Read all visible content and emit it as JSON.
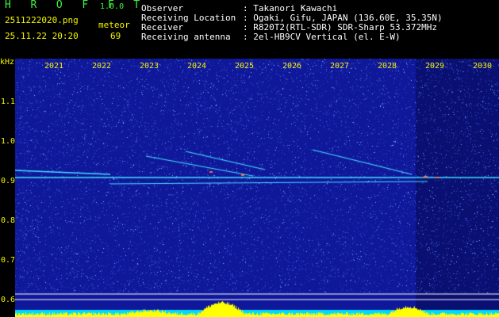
{
  "app": {
    "logo": "H R O F F T",
    "version": "1.0.0"
  },
  "file": {
    "name": "2511222020.png",
    "datetime": "25.11.22 20:20"
  },
  "meteor": {
    "label": "meteor",
    "count": "69"
  },
  "info": [
    {
      "key": "Observer",
      "value": ": Takanori Kawachi"
    },
    {
      "key": "Receiving Location",
      "value": ": Ogaki, Gifu, JAPAN (136.60E, 35.35N)"
    },
    {
      "key": "Receiver",
      "value": ": R820T2(RTL-SDR) SDR-Sharp 53.372MHz"
    },
    {
      "key": "Receiving antenna",
      "value": ": 2el-HB9CV Vertical (el. E-W)"
    }
  ],
  "y_axis": {
    "unit": "kHz",
    "ticks": [
      "1.1",
      "1.0",
      "0.9",
      "0.8",
      "0.7",
      "0.6"
    ]
  },
  "x_axis": {
    "ticks": [
      "2021",
      "2022",
      "2023",
      "2024",
      "2025",
      "2026",
      "2027",
      "2028",
      "2029",
      "2030"
    ]
  },
  "colors": {
    "background": "#10189a",
    "text_yellow": "#f4f400",
    "logo_green": "#3cf23c",
    "signal_cyan": "#40e0ff",
    "bottom_band": "#00d8ff",
    "level_yellow": "#ffff00"
  }
}
